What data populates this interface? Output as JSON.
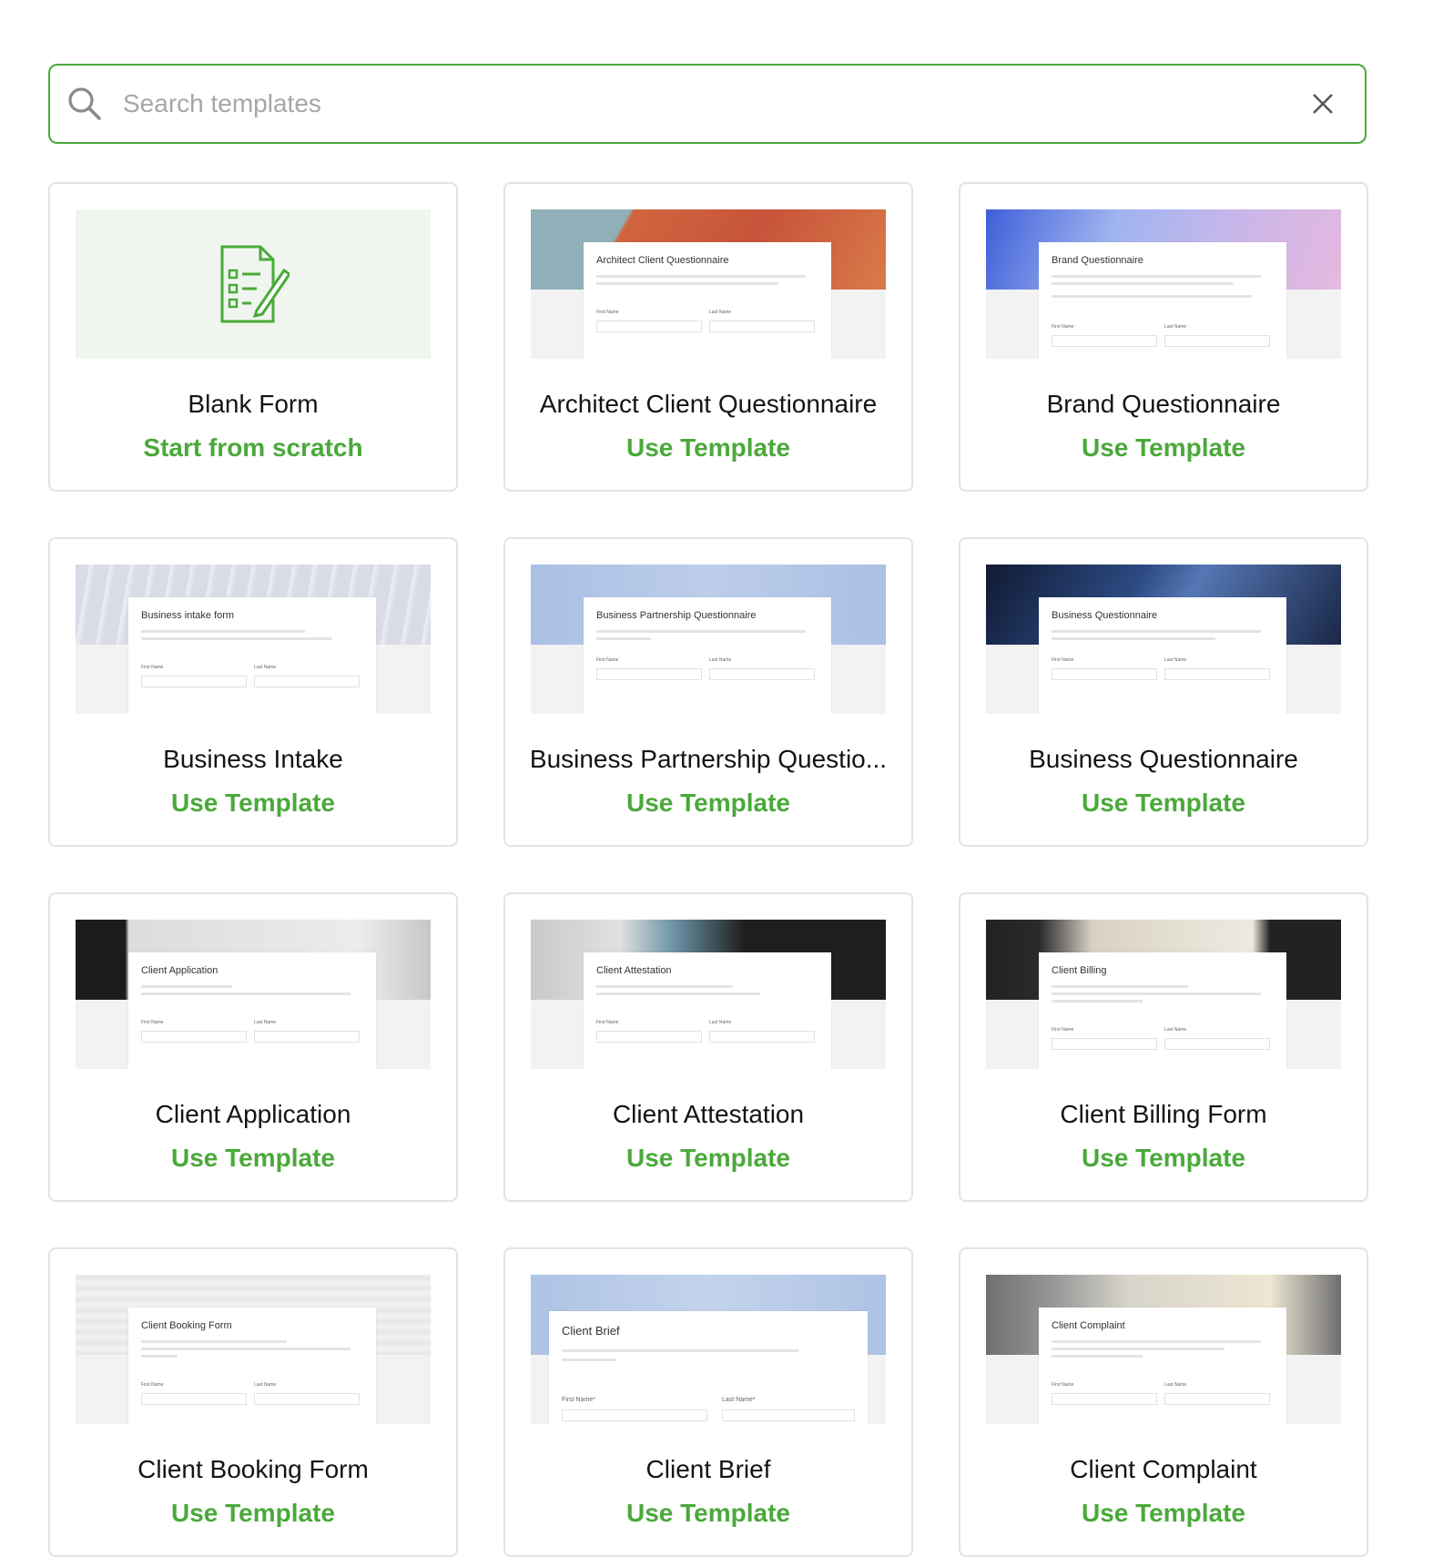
{
  "search": {
    "placeholder": "Search templates",
    "value": ""
  },
  "colors": {
    "accent": "#4aa93a",
    "border": "#e3e3e3"
  },
  "cards": [
    {
      "title": "Blank Form",
      "action": "Start from scratch",
      "icon": "form-edit-icon"
    },
    {
      "title": "Architect Client Questionnaire",
      "action": "Use Template",
      "preview_title": "Architect Client Questionnaire",
      "band": "#d1653f"
    },
    {
      "title": "Brand Questionnaire",
      "action": "Use Template",
      "preview_title": "Brand Questionnaire",
      "band": "#8a9be8"
    },
    {
      "title": "Business Intake",
      "action": "Use Template",
      "preview_title": "Business intake form",
      "band": "#dde0ea"
    },
    {
      "title": "Business Partnership Questio...",
      "action": "Use Template",
      "preview_title": "Business Partnership Questionnaire",
      "band": "#b5c8e6"
    },
    {
      "title": "Business Questionnaire",
      "action": "Use Template",
      "preview_title": "Business Questionnaire",
      "band": "#1e2b4a"
    },
    {
      "title": "Client Application",
      "action": "Use Template",
      "preview_title": "Client Application",
      "band": "#e2e2e2"
    },
    {
      "title": "Client Attestation",
      "action": "Use Template",
      "preview_title": "Client Attestation",
      "band": "#1f1f1f"
    },
    {
      "title": "Client Billing Form",
      "action": "Use Template",
      "preview_title": "Client Billing",
      "band": "#2a2a2a"
    },
    {
      "title": "Client Booking Form",
      "action": "Use Template",
      "preview_title": "Client Booking Form",
      "band": "#ececec"
    },
    {
      "title": "Client Brief",
      "action": "Use Template",
      "preview_title": "Client Brief",
      "band": "#b8cbe8"
    },
    {
      "title": "Client Complaint",
      "action": "Use Template",
      "preview_title": "Client Complaint",
      "band": "#8f8f8f"
    }
  ]
}
